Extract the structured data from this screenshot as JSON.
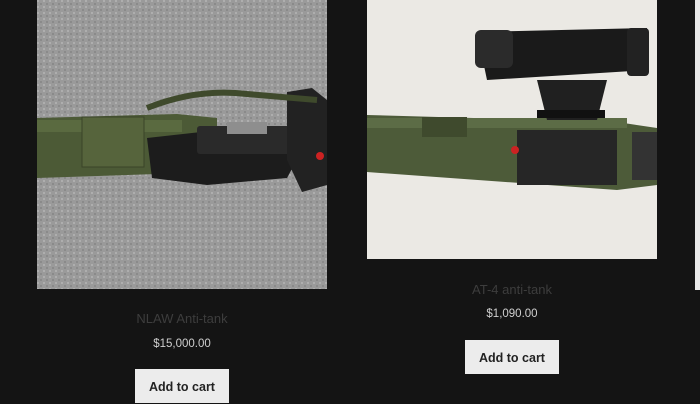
{
  "products": [
    {
      "name": "NLAW Anti-tank",
      "price": "$15,000.00",
      "button_label": "Add to cart",
      "image": "nlaw-launcher-photo"
    },
    {
      "name": "AT-4 anti-tank",
      "price": "$1,090.00",
      "button_label": "Add to cart",
      "image": "at4-launcher-photo"
    }
  ],
  "colors": {
    "page_background": "#141414",
    "title_text": "#3d3d3d",
    "price_text": "#cfcfcf",
    "button_background": "#ececec"
  }
}
